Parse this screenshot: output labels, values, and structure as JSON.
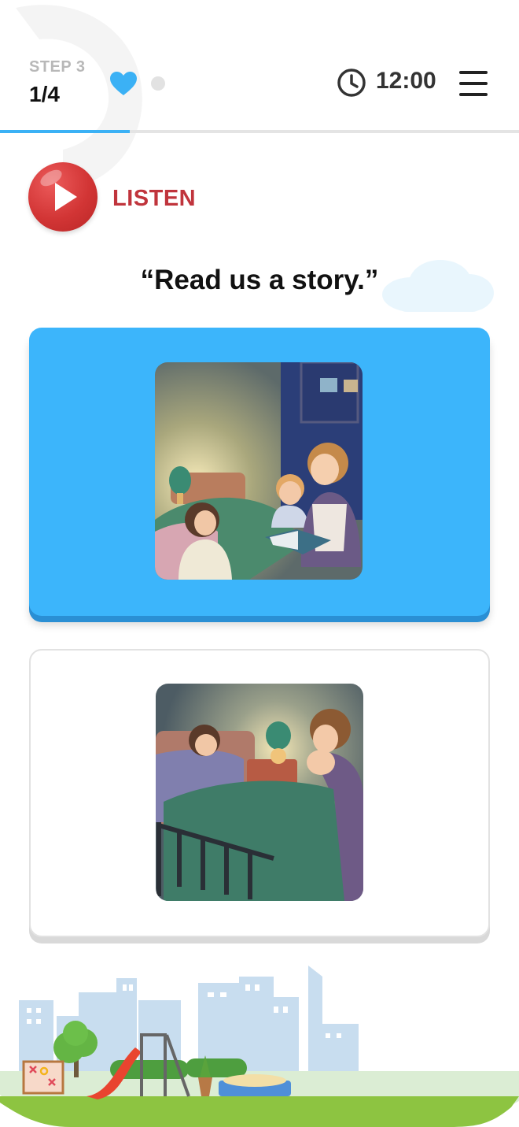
{
  "header": {
    "step_label": "STEP 3",
    "step_count": "1/4",
    "progress_fraction": 0.25,
    "lives_icon": "heart-icon",
    "timer_icon": "clock-icon",
    "timer": "12:00",
    "menu_icon": "hamburger-menu-icon"
  },
  "listen": {
    "label": "LISTEN",
    "icon": "play-icon"
  },
  "prompt": "“Read us a story.”",
  "options": [
    {
      "state": "selected",
      "image": "bedtime-story-illustration"
    },
    {
      "state": "unselected",
      "image": "tucking-in-illustration"
    }
  ],
  "colors": {
    "accent": "#3cb5fb",
    "listen_red": "#c0343c",
    "heart": "#3bb1f5",
    "progress": "#3bb1f5"
  }
}
